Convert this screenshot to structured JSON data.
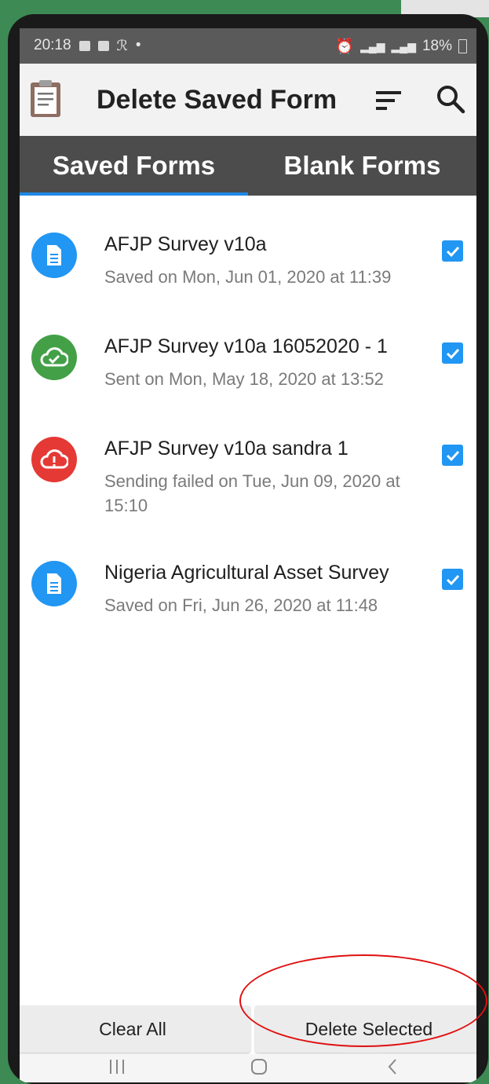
{
  "status_bar": {
    "time": "20:18",
    "left_dot": "•",
    "battery": "18%"
  },
  "app_bar": {
    "title": "Delete Saved Form",
    "icons": [
      "clipboard-icon",
      "sort-icon",
      "search-icon"
    ]
  },
  "tabs": [
    {
      "label": "Saved Forms",
      "active": true
    },
    {
      "label": "Blank Forms",
      "active": false
    }
  ],
  "forms": [
    {
      "title": "AFJP Survey v10a",
      "subtitle": "Saved on Mon, Jun 01, 2020 at 11:39",
      "status": "saved",
      "icon": "document-icon",
      "color": "#2196f3",
      "checked": true
    },
    {
      "title": "AFJP Survey v10a 16052020 - 1",
      "subtitle": "Sent on Mon, May 18, 2020 at 13:52",
      "status": "sent",
      "icon": "cloud-check-icon",
      "color": "#43a047",
      "checked": true
    },
    {
      "title": "AFJP Survey v10a sandra 1",
      "subtitle": "Sending failed on Tue, Jun 09, 2020 at 15:10",
      "status": "failed",
      "icon": "cloud-alert-icon",
      "color": "#e53935",
      "checked": true
    },
    {
      "title": "Nigeria Agricultural Asset Survey",
      "subtitle": "Saved on Fri, Jun 26, 2020 at 11:48",
      "status": "saved",
      "icon": "document-icon",
      "color": "#2196f3",
      "checked": true
    }
  ],
  "buttons": {
    "clear_all": "Clear All",
    "delete_selected": "Delete Selected"
  },
  "nav_bar": {
    "icons": [
      "recent-apps-icon",
      "home-icon",
      "back-icon"
    ]
  },
  "annotation_color": "#e01010"
}
